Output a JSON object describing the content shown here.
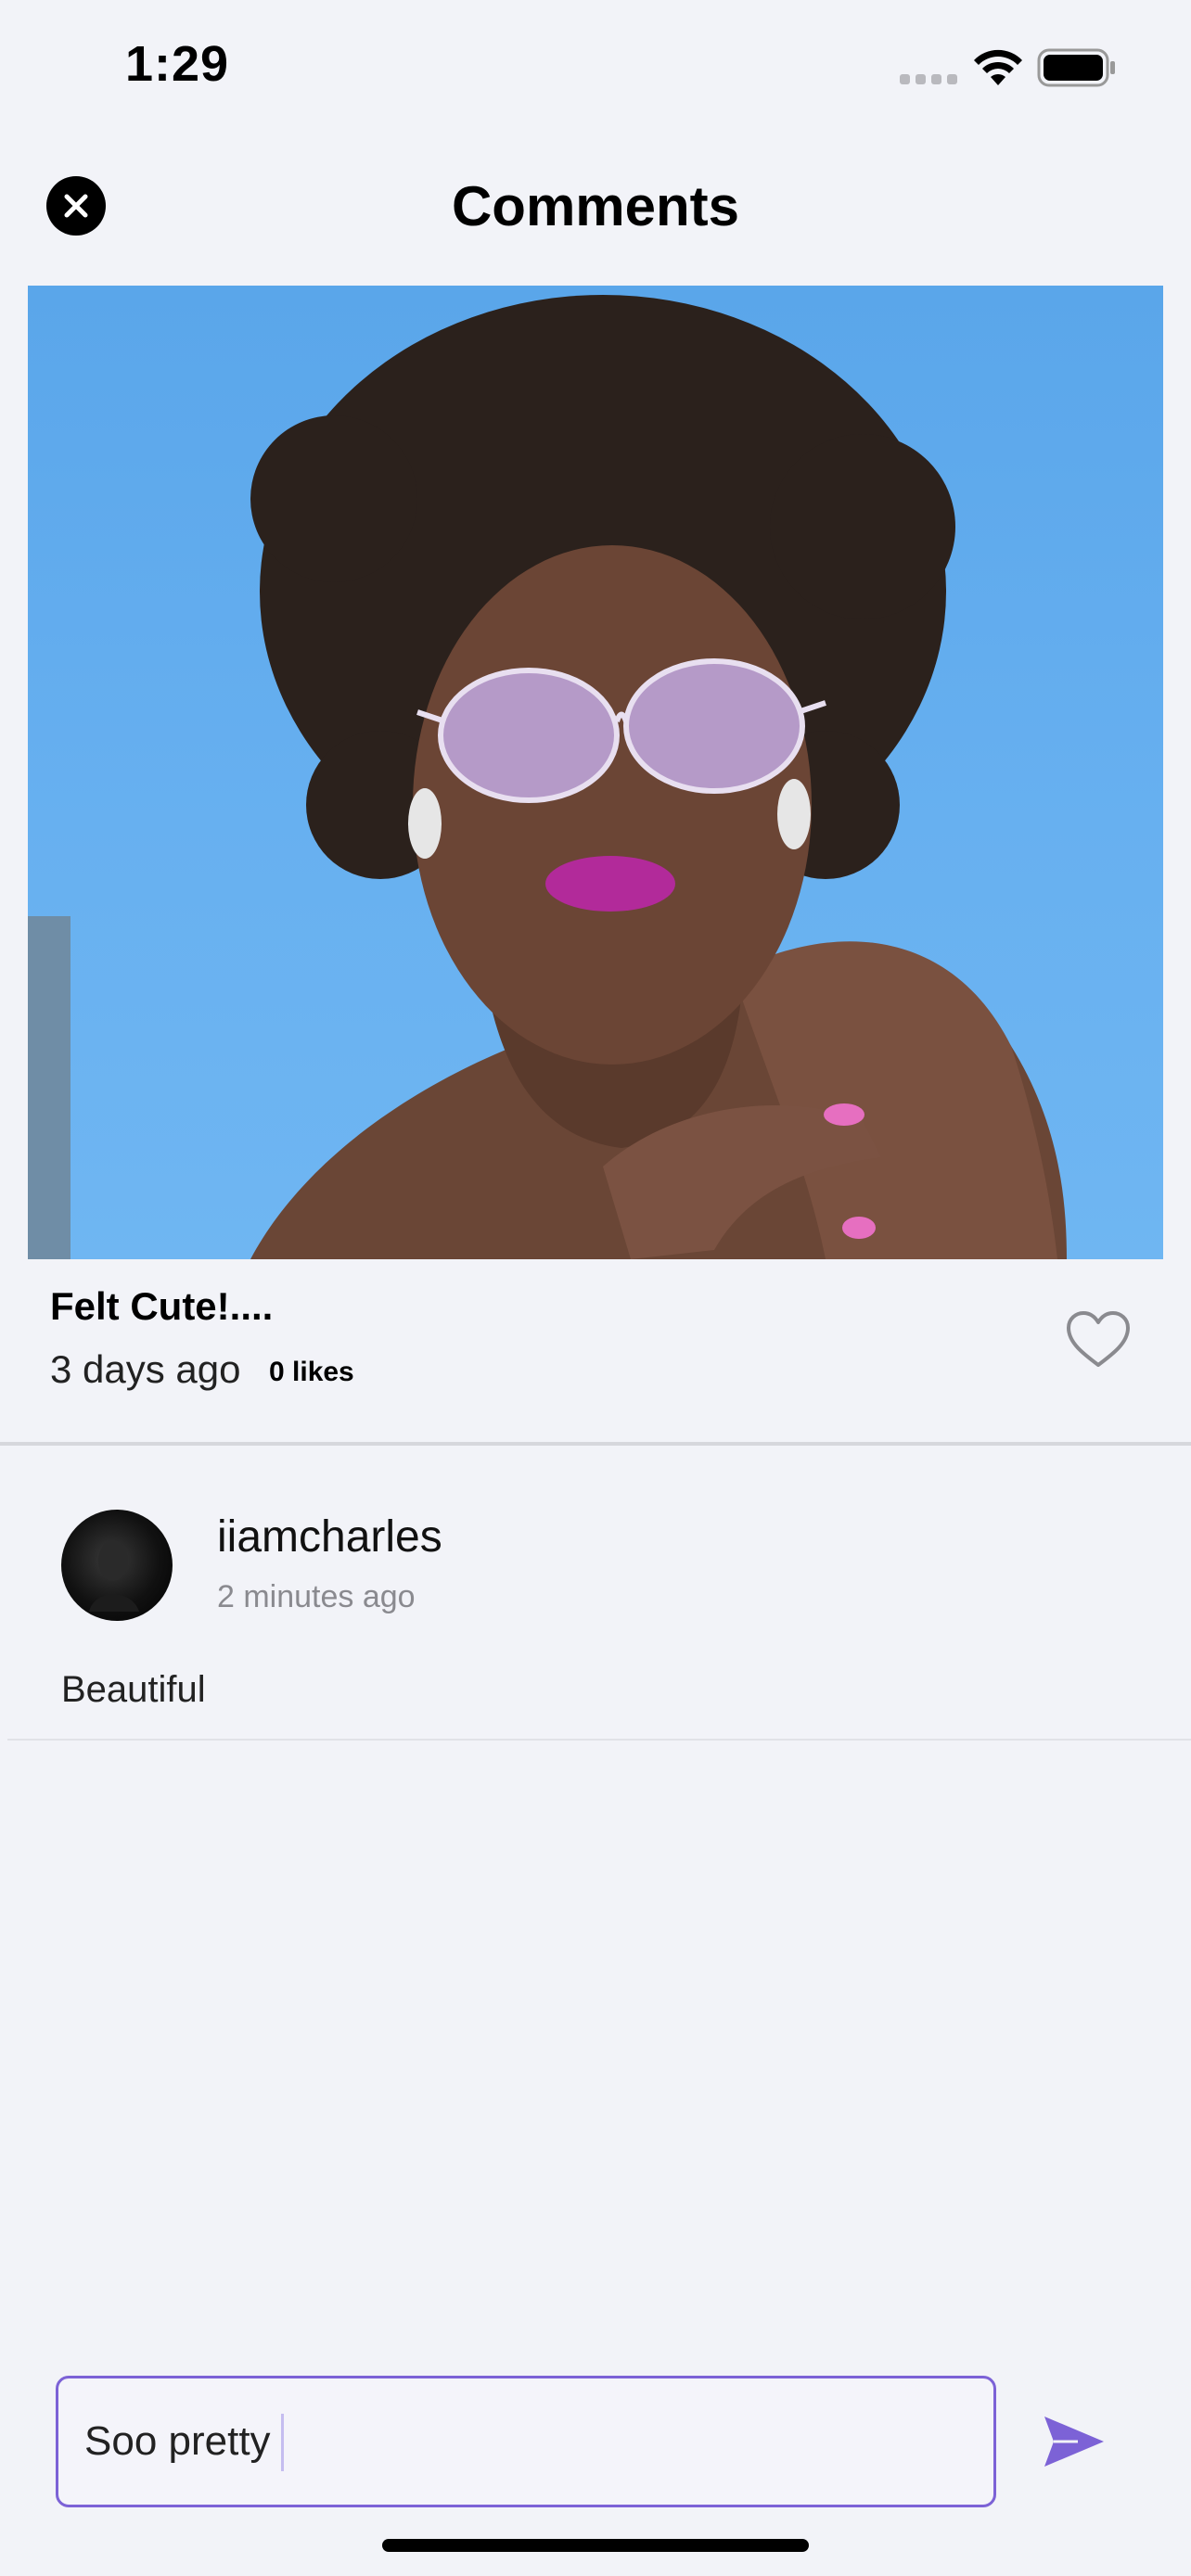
{
  "status_bar": {
    "time": "1:29"
  },
  "header": {
    "title": "Comments"
  },
  "post": {
    "caption": "Felt Cute!....",
    "time_ago": "3 days ago",
    "likes": "0 likes"
  },
  "comments": [
    {
      "username": "iiamcharles",
      "time_ago": "2 minutes ago",
      "text": "Beautiful"
    }
  ],
  "composer": {
    "value": "Soo pretty"
  },
  "colors": {
    "accent": "#7c62d6",
    "background": "#f2f3f8"
  },
  "icons": {
    "close": "close-icon",
    "like": "heart-outline-icon",
    "send": "send-icon",
    "wifi": "wifi-icon",
    "battery": "battery-icon"
  }
}
